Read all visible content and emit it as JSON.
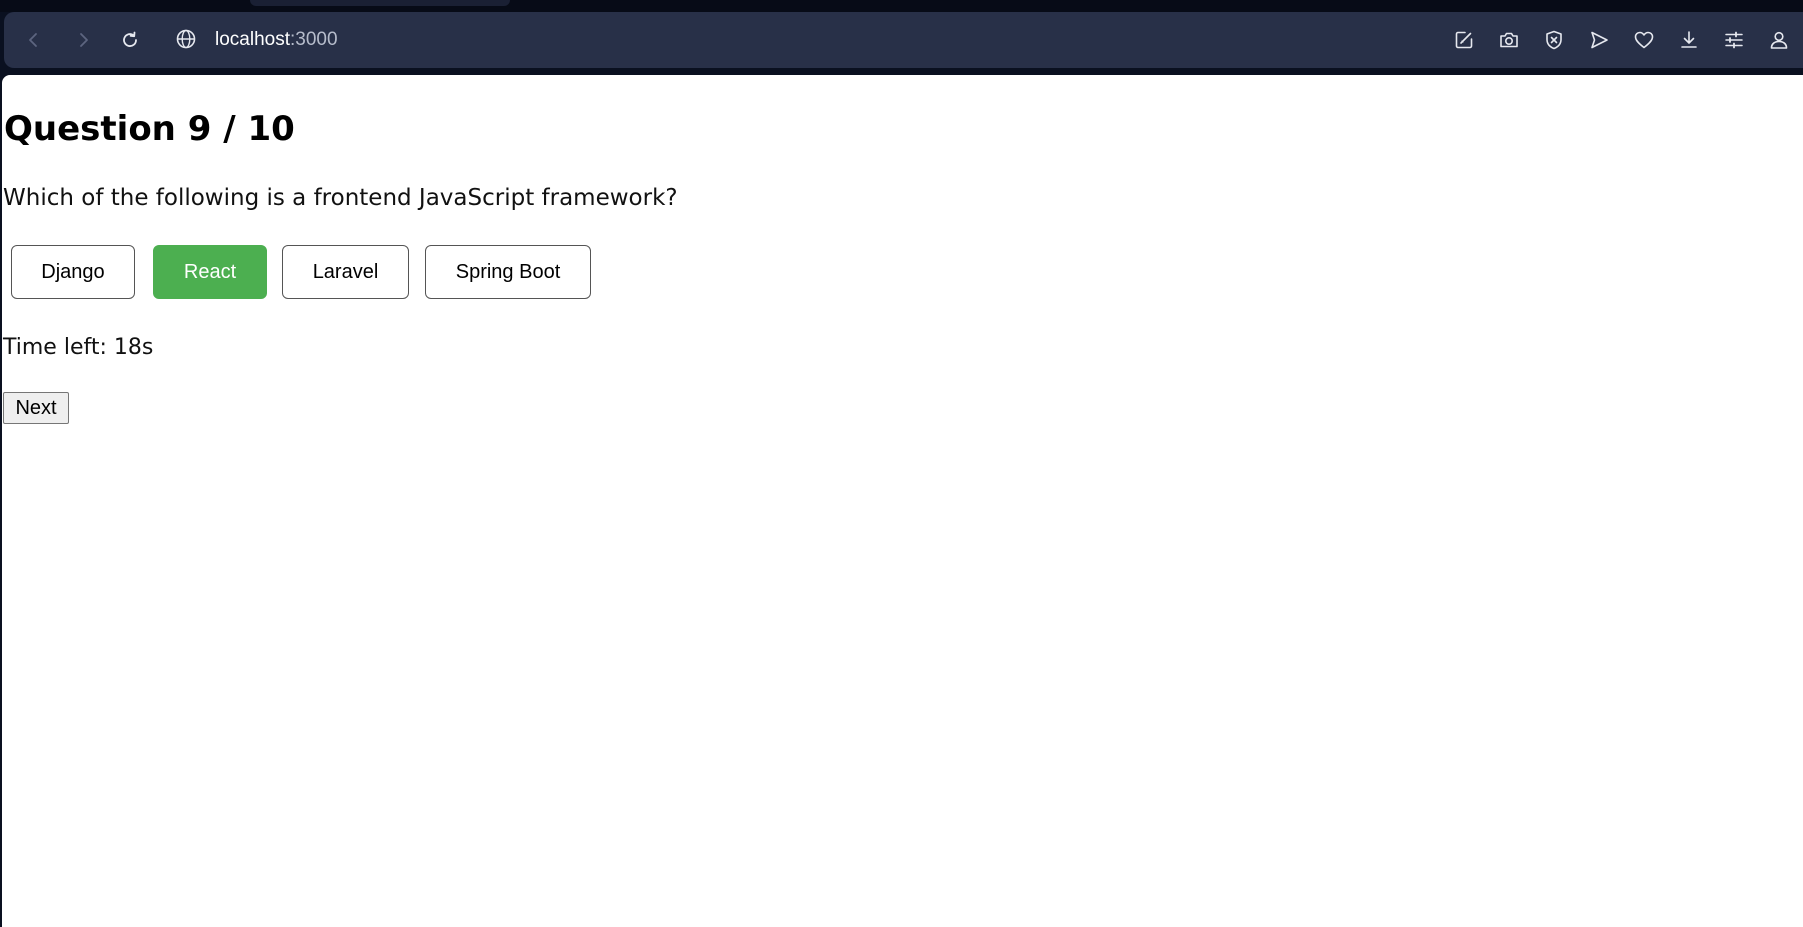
{
  "browser": {
    "url_host": "localhost",
    "url_port": ":3000",
    "icons": {
      "back": "chevron-left-icon",
      "forward": "chevron-right-icon",
      "reload": "reload-icon",
      "site_info": "globe-icon",
      "toolbar": [
        "edit-icon",
        "camera-icon",
        "shield-icon",
        "send-icon",
        "heart-icon",
        "download-icon",
        "sliders-icon",
        "account-icon"
      ]
    }
  },
  "quiz": {
    "title": "Question 9 / 10",
    "question": "Which of the following is a frontend JavaScript framework?",
    "options": [
      {
        "label": "Django",
        "selected": false
      },
      {
        "label": "React",
        "selected": true
      },
      {
        "label": "Laravel",
        "selected": false
      },
      {
        "label": "Spring Boot",
        "selected": false
      }
    ],
    "timer": "Time left: 18s",
    "next_label": "Next"
  },
  "colors": {
    "selected_option": "#4caf50",
    "toolbar_bg": "#283048",
    "frame_bg": "#0a1020"
  }
}
